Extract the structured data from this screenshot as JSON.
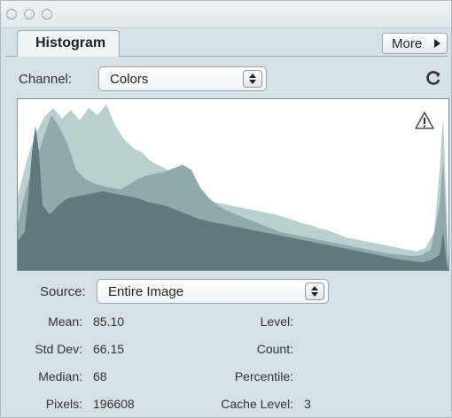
{
  "panel": {
    "tab_label": "Histogram",
    "more_label": "More"
  },
  "channel": {
    "label": "Channel:",
    "value": "Colors"
  },
  "source": {
    "label": "Source:",
    "value": "Entire Image"
  },
  "stats": {
    "mean": {
      "label": "Mean:",
      "value": "85.10"
    },
    "std_dev": {
      "label": "Std Dev:",
      "value": "66.15"
    },
    "median": {
      "label": "Median:",
      "value": "68"
    },
    "pixels": {
      "label": "Pixels:",
      "value": "196608"
    },
    "level": {
      "label": "Level:",
      "value": ""
    },
    "count": {
      "label": "Count:",
      "value": ""
    },
    "percentile": {
      "label": "Percentile:",
      "value": ""
    },
    "cache_level": {
      "label": "Cache Level:",
      "value": "3"
    }
  },
  "icons": {
    "refresh": "refresh-icon",
    "warning": "warning-icon",
    "disclosure": "triangle-right-icon"
  },
  "colors": {
    "panel_bg": "#d5e0e7",
    "histogram_dark": "#5f797c",
    "histogram_mid": "#90a9ab",
    "histogram_light": "#b9cfd0"
  }
}
